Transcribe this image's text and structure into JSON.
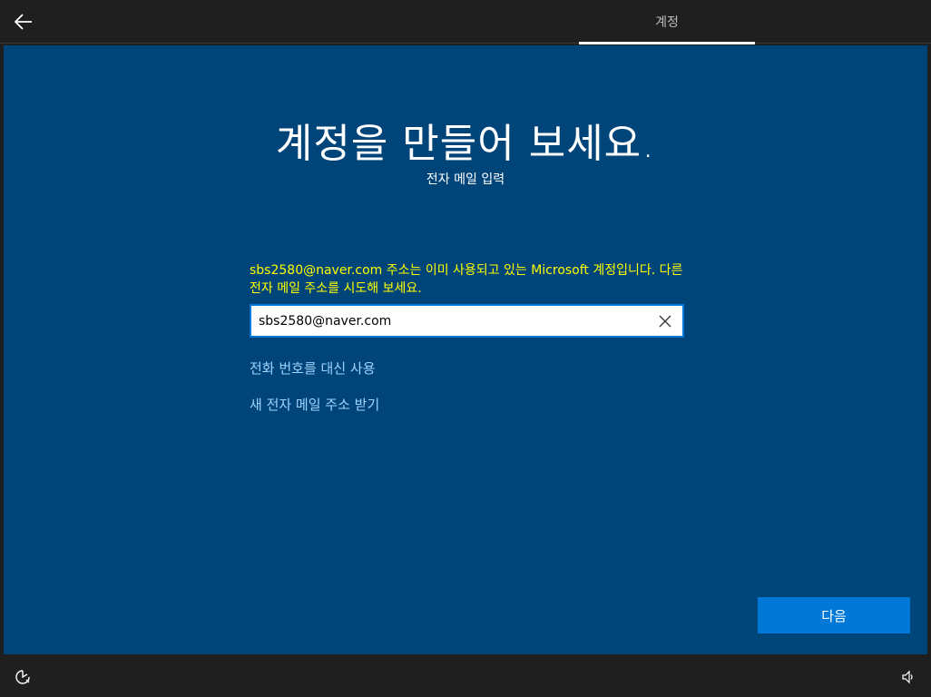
{
  "header": {
    "tab_label": "계정"
  },
  "main": {
    "title": "계정을 만들어 보세요.",
    "subtitle": "전자 메일 입력",
    "error_message": "sbs2580@naver.com 주소는 이미 사용되고 있는 Microsoft 계정입니다. 다른 전자 메일 주소를 시도해 보세요.",
    "email_field": {
      "value": "sbs2580@naver.com",
      "placeholder": ""
    },
    "link_phone": "전화 번호를 대신 사용",
    "link_new_email": "새 전자 메일 주소 받기",
    "next_button": "다음"
  },
  "icons": {
    "back": "back-arrow-icon",
    "clear": "close-icon",
    "ease_of_access": "ease-of-access-icon",
    "volume": "volume-icon"
  },
  "colors": {
    "background": "#00457a",
    "accent": "#0078d7",
    "error": "#ffff00",
    "link": "#9fd3ff",
    "bar": "#1f1f1f"
  }
}
